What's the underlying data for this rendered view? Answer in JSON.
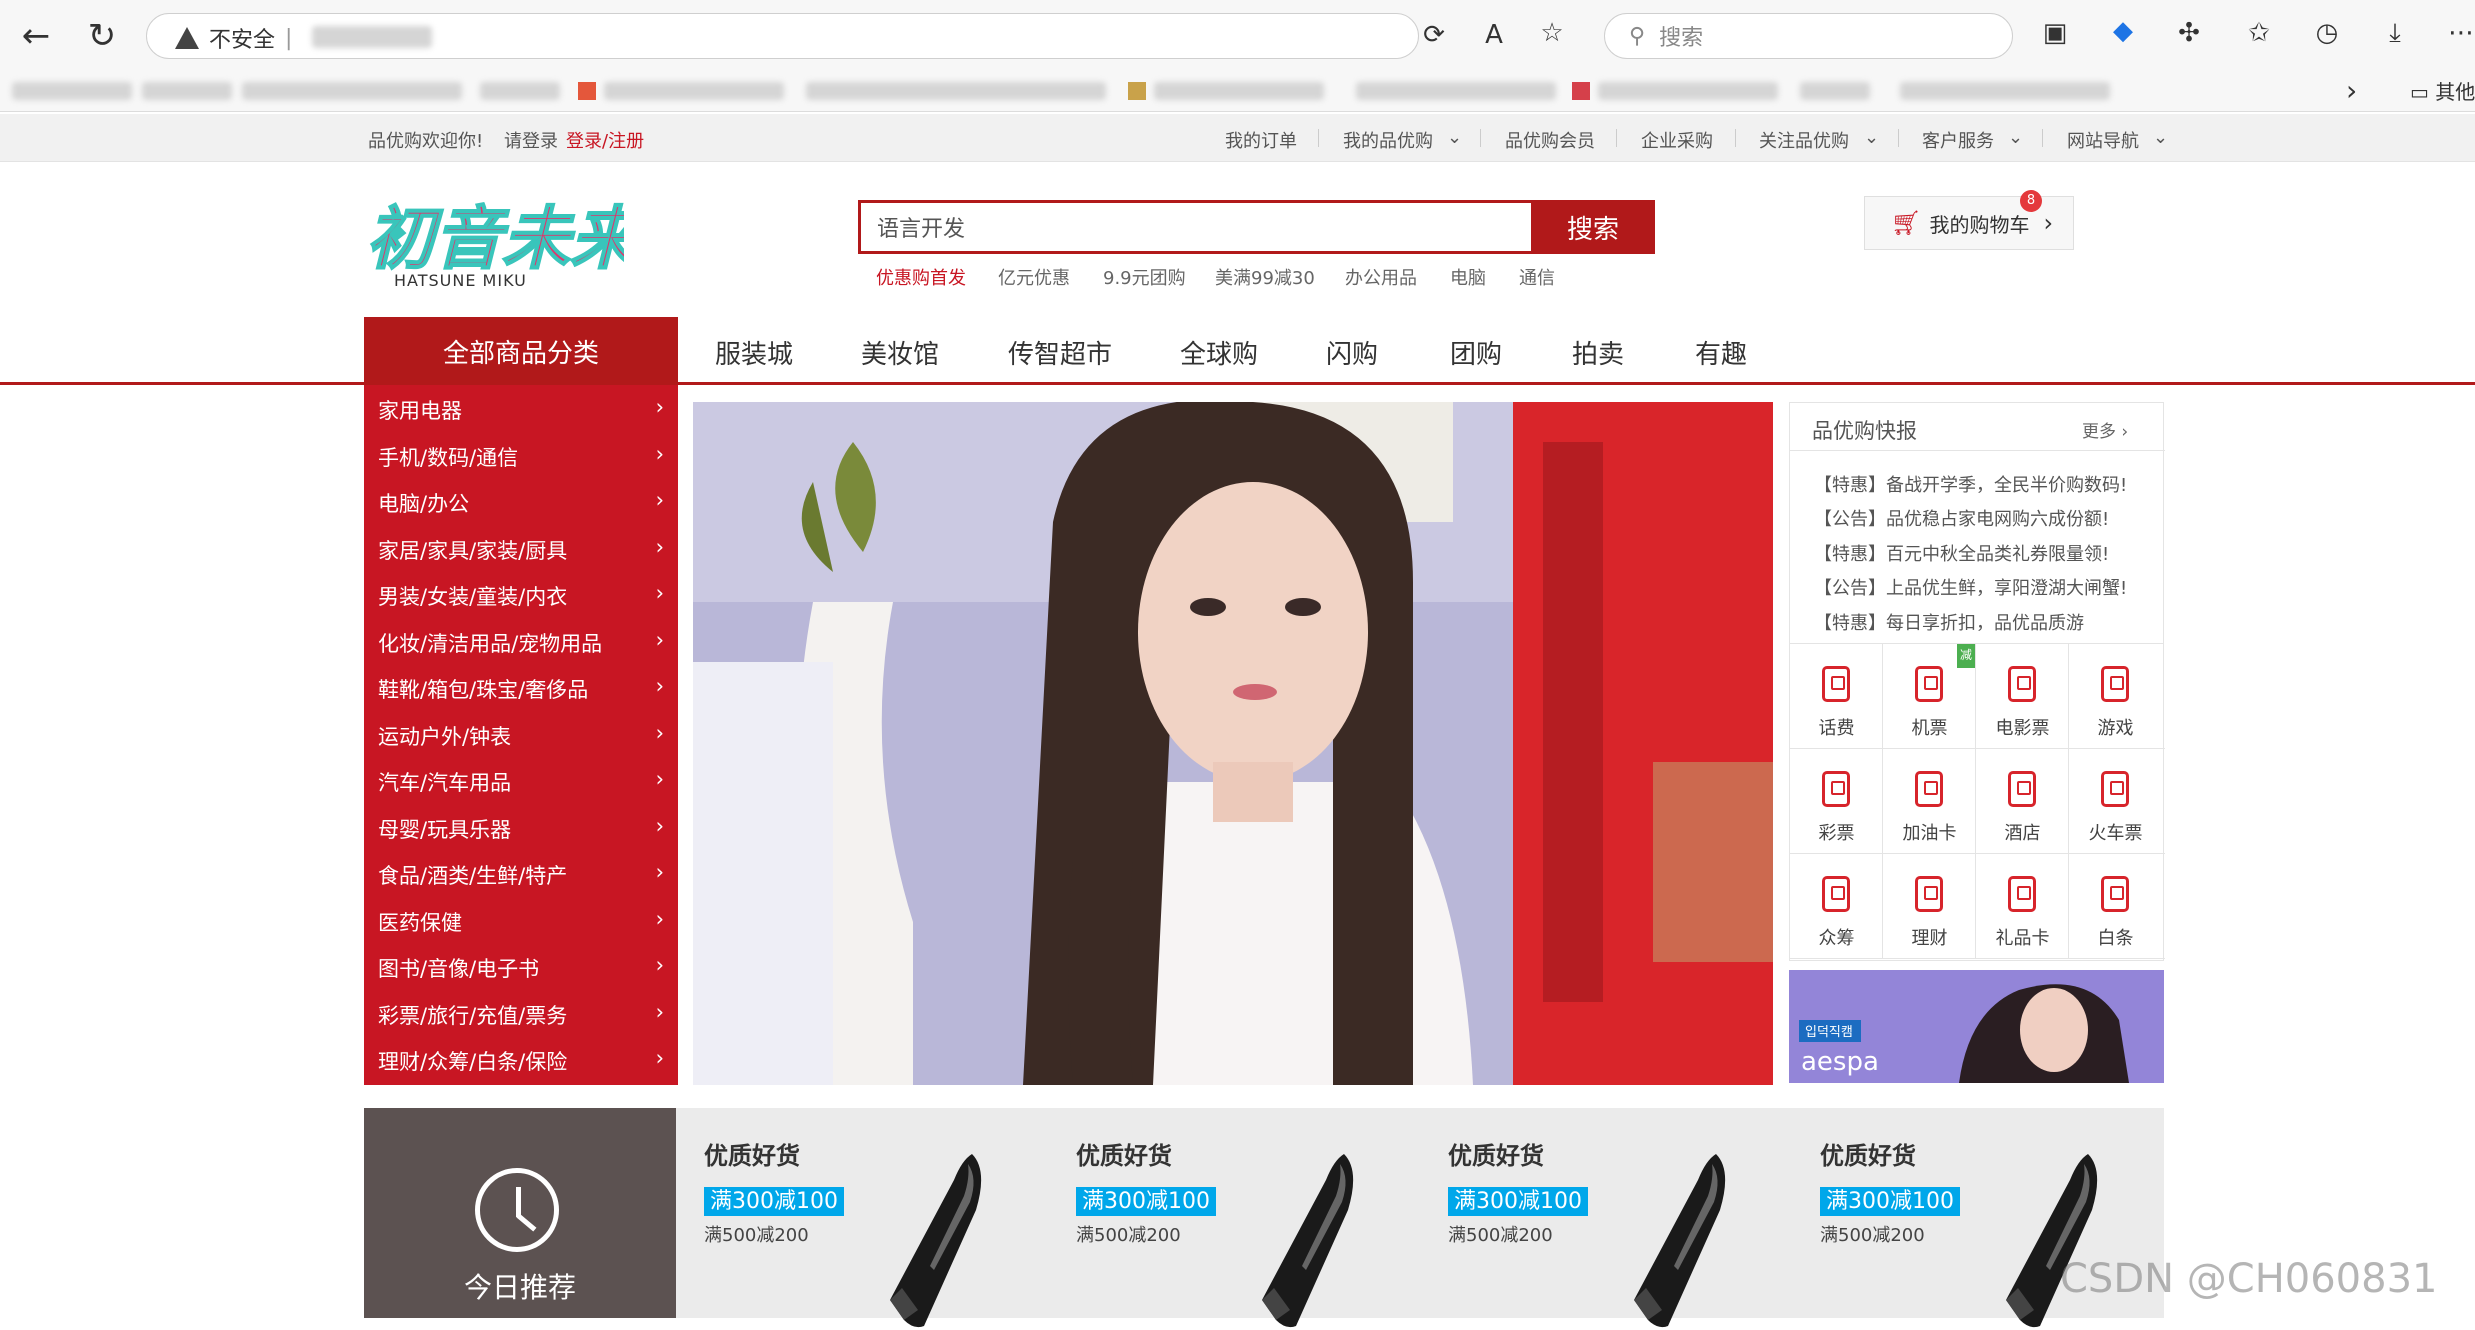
{
  "browser": {
    "security_label": "不安全",
    "search_placeholder": "搜索",
    "bookmarks_more": "其他"
  },
  "shortcut": {
    "welcome": "品优购欢迎你!",
    "login": "请登录",
    "register": "登录/注册",
    "links": [
      "我的订单",
      "我的品优购",
      "品优购会员",
      "企业采购",
      "关注品优购",
      "客户服务",
      "网站导航"
    ]
  },
  "header": {
    "logo_main": "初音未来",
    "logo_sub": "HATSUNE MIKU",
    "search_value": "语言开发",
    "search_button": "搜索",
    "hot_words": [
      "优惠购首发",
      "亿元优惠",
      "9.9元团购",
      "美满99减30",
      "办公用品",
      "电脑",
      "通信"
    ],
    "cart_label": "我的购物车",
    "cart_count": "8"
  },
  "nav": {
    "all_categories": "全部商品分类",
    "links": [
      "服装城",
      "美妆馆",
      "传智超市",
      "全球购",
      "闪购",
      "团购",
      "拍卖",
      "有趣"
    ]
  },
  "categories": [
    "家用电器",
    "手机/数码/通信",
    "电脑/办公",
    "家居/家具/家装/厨具",
    "男装/女装/童装/内衣",
    "化妆/清洁用品/宠物用品",
    "鞋靴/箱包/珠宝/奢侈品",
    "运动户外/钟表",
    "汽车/汽车用品",
    "母婴/玩具乐器",
    "食品/酒类/生鲜/特产",
    "医药保健",
    "图书/音像/电子书",
    "彩票/旅行/充值/票务",
    "理财/众筹/白条/保险"
  ],
  "news": {
    "title": "品优购快报",
    "more": "更多",
    "items": [
      "【特惠】备战开学季，全民半价购数码!",
      "【公告】品优稳占家电网购六成份额!",
      "【特惠】百元中秋全品类礼券限量领!",
      "【公告】上品优生鲜，享阳澄湖大闸蟹!",
      "【特惠】每日享折扣，品优品质游"
    ]
  },
  "services": [
    "话费",
    "机票",
    "电影票",
    "游戏",
    "彩票",
    "加油卡",
    "酒店",
    "火车票",
    "众筹",
    "理财",
    "礼品卡",
    "白条"
  ],
  "services_hot_badge": "减",
  "ad": {
    "tag": "입덕직캠",
    "brand": "aespa"
  },
  "recommend": {
    "title": "今日推荐",
    "cards": [
      {
        "title": "优质好货",
        "badge": "满300减100",
        "sub": "满500减200"
      },
      {
        "title": "优质好货",
        "badge": "满300减100",
        "sub": "满500减200"
      },
      {
        "title": "优质好货",
        "badge": "满300减100",
        "sub": "满500减200"
      },
      {
        "title": "优质好货",
        "badge": "满300减100",
        "sub": "满500减200"
      }
    ]
  },
  "watermark": "CSDN @CH060831"
}
